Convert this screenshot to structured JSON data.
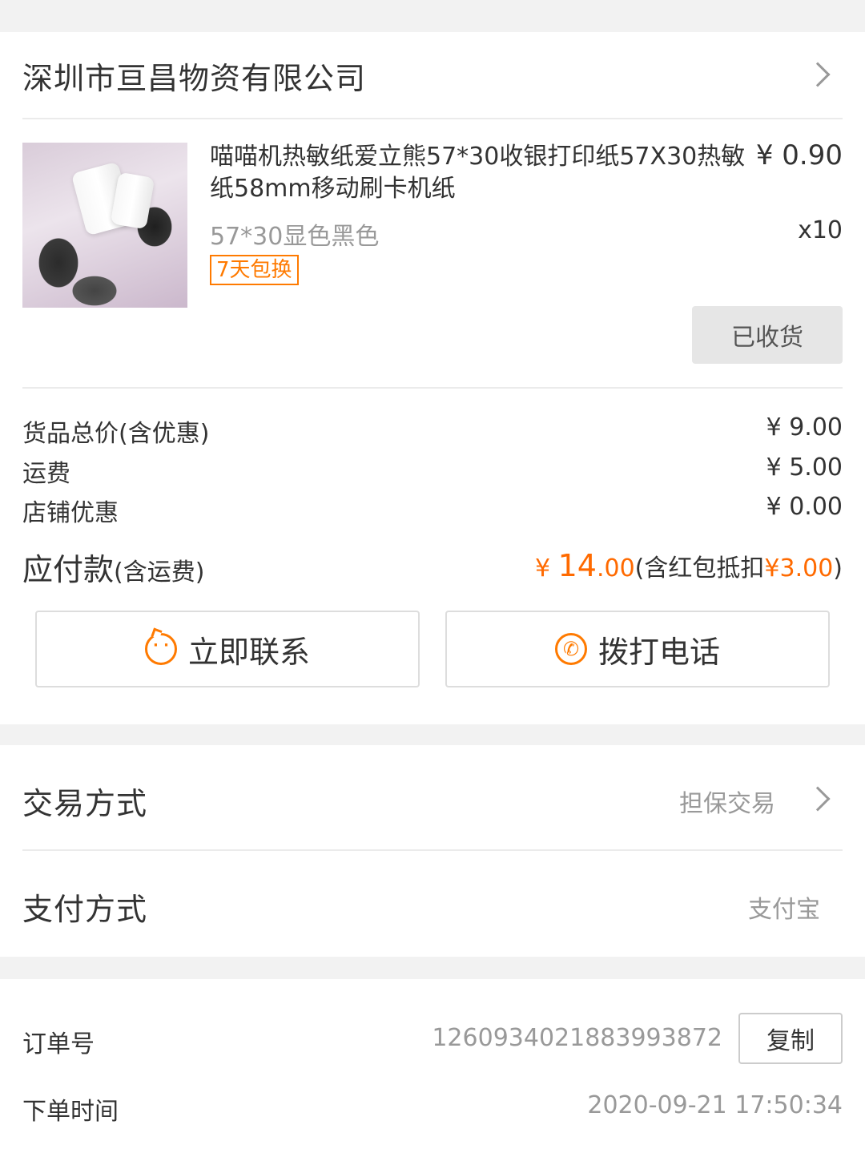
{
  "shop": {
    "name": "深圳市亘昌物资有限公司"
  },
  "product": {
    "title": "喵喵机热敏纸爱立熊57*30收银打印纸57X30热敏纸58mm移动刷卡机纸",
    "price": "¥ 0.90",
    "spec": "57*30显色黑色",
    "quantity": "x10",
    "tag": "7天包换",
    "status_button": "已收货"
  },
  "fees": [
    {
      "label": "货品总价(含优惠)",
      "value": "¥ 9.00"
    },
    {
      "label": "运费",
      "value": "¥ 5.00"
    },
    {
      "label": "店铺优惠",
      "value": "¥ 0.00"
    }
  ],
  "payable": {
    "label": "应付款",
    "label_sub": "(含运费)",
    "currency": "¥ ",
    "amount_int": "14",
    "amount_dec": ".00",
    "note_prefix": "(含红包抵扣",
    "note_amount": "¥3.00",
    "note_suffix": ")"
  },
  "actions": {
    "contact": "立即联系",
    "call": "拨打电话"
  },
  "trade": {
    "label": "交易方式",
    "value": "担保交易"
  },
  "payment": {
    "label": "支付方式",
    "value": "支付宝"
  },
  "order": {
    "number_label": "订单号",
    "number": "1260934021883993872",
    "copy_label": "复制",
    "time_label": "下单时间",
    "time": "2020-09-21 17:50:34"
  },
  "colors": {
    "accent": "#ff6a00",
    "tag": "#ff7a00",
    "background": "#f2f2f2"
  }
}
